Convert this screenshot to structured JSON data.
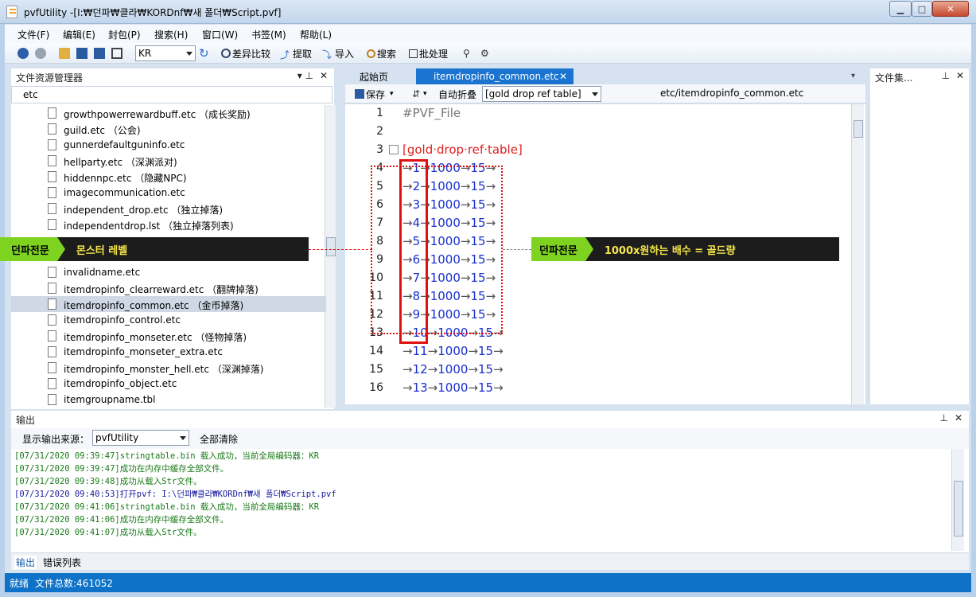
{
  "window": {
    "title": "pvfUtility -[I:₩던파₩클라₩KORDnf₩새 폴더₩Script.pvf]",
    "minimize_label": "▁",
    "maximize_label": "□",
    "close_label": "✕"
  },
  "menu": [
    "文件(F)",
    "编辑(E)",
    "封包(P)",
    "搜索(H)",
    "窗口(W)",
    "书签(M)",
    "帮助(L)"
  ],
  "toolbar": {
    "encoding_value": "KR",
    "compare_label": "差异比较",
    "extract_label": "提取",
    "import_label": "导入",
    "search_label": "搜索",
    "batch_label": "批处理"
  },
  "explorer": {
    "header": "文件资源管理器",
    "search_value": "etc",
    "files": [
      "growthpowerrewardbuff.etc （成长奖励)",
      "guild.etc （公会)",
      "gunnerdefaultguninfo.etc",
      "hellparty.etc （深渊派对)",
      "hiddennpc.etc （隐藏NPC)",
      "imagecommunication.etc",
      "independent_drop.etc （独立掉落)",
      "independentdrop.lst （独立掉落列表)",
      "",
      "",
      "invalidname.etc",
      "itemdropinfo_clearreward.etc （翻牌掉落)",
      "itemdropinfo_common.etc （金币掉落)",
      "itemdropinfo_control.etc",
      "itemdropinfo_monseter.etc （怪物掉落)",
      "itemdropinfo_monseter_extra.etc",
      "itemdropinfo_monster_hell.etc （深渊掉落)",
      "itemdropinfo_object.etc",
      "itemgroupname.tbl"
    ],
    "selected_index": 12
  },
  "editor": {
    "tab_start": "起始页",
    "tab_file": "itemdropinfo_common.etc",
    "save_label": "保存",
    "autofold_label": "自动折叠",
    "section_value": "[gold drop ref table]",
    "path": "etc/itemdropinfo_common.etc",
    "lines": [
      {
        "n": "1",
        "text": "#PVF_File"
      },
      {
        "n": "2",
        "text": ""
      },
      {
        "n": "3",
        "text": "[gold·drop·ref·table]"
      },
      {
        "n": "4",
        "a": "1",
        "b": "1000",
        "c": "15"
      },
      {
        "n": "5",
        "a": "2",
        "b": "1000",
        "c": "15"
      },
      {
        "n": "6",
        "a": "3",
        "b": "1000",
        "c": "15"
      },
      {
        "n": "7",
        "a": "4",
        "b": "1000",
        "c": "15"
      },
      {
        "n": "8",
        "a": "5",
        "b": "1000",
        "c": "15"
      },
      {
        "n": "9",
        "a": "6",
        "b": "1000",
        "c": "15"
      },
      {
        "n": "10",
        "a": "7",
        "b": "1000",
        "c": "15"
      },
      {
        "n": "11",
        "a": "8",
        "b": "1000",
        "c": "15"
      },
      {
        "n": "12",
        "a": "9",
        "b": "1000",
        "c": "15"
      },
      {
        "n": "13",
        "a": "10",
        "b": "1000",
        "c": "15"
      },
      {
        "n": "14",
        "a": "11",
        "b": "1000",
        "c": "15"
      },
      {
        "n": "15",
        "a": "12",
        "b": "1000",
        "c": "15"
      },
      {
        "n": "16",
        "a": "13",
        "b": "1000",
        "c": "15"
      }
    ]
  },
  "right_panel": {
    "header": "文件集..."
  },
  "annotations": {
    "left_tag": "던파전문",
    "left_text": "몬스터 레벨",
    "right_tag": "던파전문",
    "right_text": "1000x원하는 배수 = 골드량"
  },
  "output": {
    "header": "输出",
    "source_label": "显示输出来源：",
    "source_value": "pvfUtility",
    "clear_label": "全部清除",
    "logs": [
      {
        "text": "[07/31/2020 09:39:47]stringtable.bin 载入成功，当前全局编码器：KR",
        "color": "#1a7a1a"
      },
      {
        "text": "[07/31/2020 09:39:47]成功在内存中缓存全部文件。",
        "color": "#1a7a1a"
      },
      {
        "text": "[07/31/2020 09:39:48]成功从载入Str文件。",
        "color": "#1a7a1a"
      },
      {
        "text": "[07/31/2020 09:40:53]打开pvf: I:\\던파₩클라₩KORDnf₩새 폴더₩Script.pvf",
        "color": "#1a1aa0"
      },
      {
        "text": "[07/31/2020 09:41:06]stringtable.bin 载入成功，当前全局编码器：KR",
        "color": "#1a7a1a"
      },
      {
        "text": "[07/31/2020 09:41:06]成功在内存中缓存全部文件。",
        "color": "#1a7a1a"
      },
      {
        "text": "[07/31/2020 09:41:07]成功从载入Str文件。",
        "color": "#1a7a1a"
      }
    ],
    "tab_output": "输出",
    "tab_errors": "错误列表"
  },
  "status": {
    "ready": "就绪",
    "total_files": "文件总数:461052"
  },
  "colors": {
    "accent": "#0e73c8",
    "annotation_red": "#e01010",
    "annotation_green": "#7ed321"
  }
}
